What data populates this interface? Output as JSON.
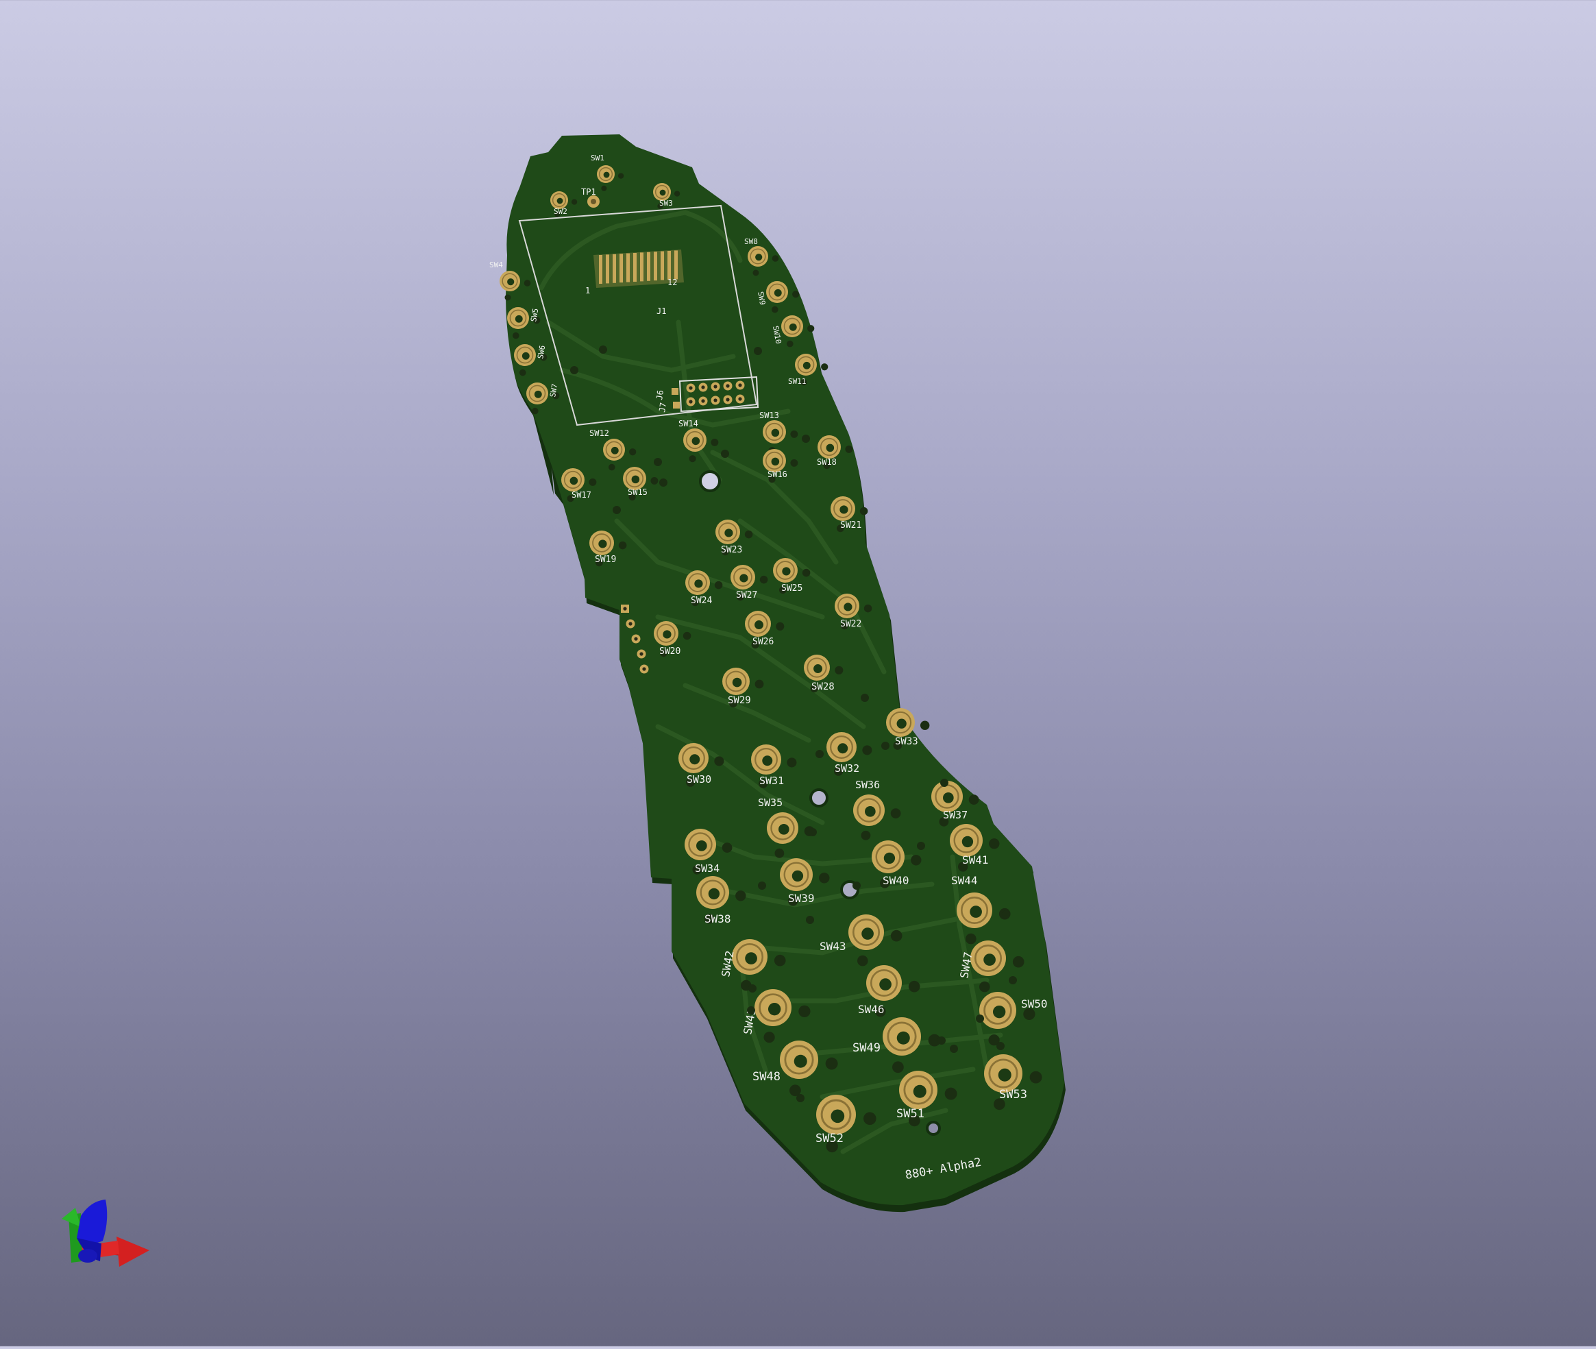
{
  "viewer": {
    "background_top": "#cbcbe4",
    "background_bottom": "#66667f"
  },
  "board": {
    "label": "880+ Alpha2",
    "substrate_color": "#1f4a18",
    "edge_color": "#14300f",
    "pad_color": "#c9a85a",
    "silkscreen_color": "#f2f2f2",
    "connector_labels": {
      "j1": "J1",
      "j6": "J6",
      "j7": "J7",
      "tp1": "TP1",
      "pin1": "1",
      "pin12": "12"
    },
    "switches": [
      {
        "label": "SW1"
      },
      {
        "label": "SW2"
      },
      {
        "label": "SW3"
      },
      {
        "label": "SW4"
      },
      {
        "label": "SW5"
      },
      {
        "label": "SW6"
      },
      {
        "label": "SW7"
      },
      {
        "label": "SW8"
      },
      {
        "label": "SW9"
      },
      {
        "label": "SW10"
      },
      {
        "label": "SW11"
      },
      {
        "label": "SW12"
      },
      {
        "label": "SW13"
      },
      {
        "label": "SW14"
      },
      {
        "label": "SW15"
      },
      {
        "label": "SW16"
      },
      {
        "label": "SW17"
      },
      {
        "label": "SW18"
      },
      {
        "label": "SW19"
      },
      {
        "label": "SW20"
      },
      {
        "label": "SW21"
      },
      {
        "label": "SW22"
      },
      {
        "label": "SW23"
      },
      {
        "label": "SW24"
      },
      {
        "label": "SW25"
      },
      {
        "label": "SW26"
      },
      {
        "label": "SW27"
      },
      {
        "label": "SW28"
      },
      {
        "label": "SW29"
      },
      {
        "label": "SW30"
      },
      {
        "label": "SW31"
      },
      {
        "label": "SW32"
      },
      {
        "label": "SW33"
      },
      {
        "label": "SW34"
      },
      {
        "label": "SW35"
      },
      {
        "label": "SW36"
      },
      {
        "label": "SW37"
      },
      {
        "label": "SW38"
      },
      {
        "label": "SW39"
      },
      {
        "label": "SW40"
      },
      {
        "label": "SW41"
      },
      {
        "label": "SW42"
      },
      {
        "label": "SW43"
      },
      {
        "label": "SW44"
      },
      {
        "label": "SW45"
      },
      {
        "label": "SW46"
      },
      {
        "label": "SW47"
      },
      {
        "label": "SW48"
      },
      {
        "label": "SW49"
      },
      {
        "label": "SW50"
      },
      {
        "label": "SW51"
      },
      {
        "label": "SW52"
      },
      {
        "label": "SW53"
      }
    ]
  },
  "axes_gizmo": {
    "x_color": "#d42020",
    "y_color": "#20b020",
    "z_color": "#1a1ad8"
  }
}
